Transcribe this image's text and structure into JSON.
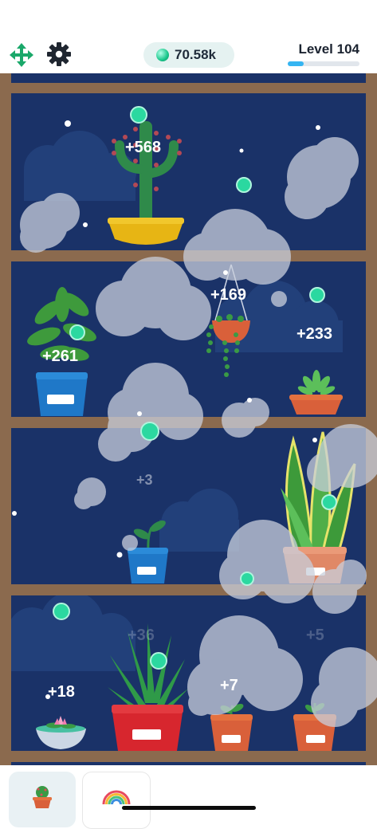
{
  "header": {
    "move_icon": "move-arrows-icon",
    "settings_icon": "gear-icon",
    "currency": {
      "icon": "green-gem-icon",
      "value": "70.58k"
    },
    "level": {
      "label": "Level 104",
      "progress": 0.22
    }
  },
  "shelves": [
    {
      "name": "top-shelf",
      "plants": [
        "cactus-in-yellow-bowl"
      ]
    },
    {
      "name": "second-shelf",
      "plants": [
        "fern-in-blue-pot",
        "hanging-pearl-plant",
        "succulent-in-terracotta-dish"
      ]
    },
    {
      "name": "third-shelf",
      "plants": [
        "seedling-in-blue-pot",
        "snake-plant-in-salmon-pot"
      ]
    },
    {
      "name": "bottom-shelf",
      "plants": [
        "water-lily-bowl",
        "aloe-in-red-pot",
        "sprout-in-terracotta-pot",
        "sprout-in-small-terracotta-pot"
      ]
    }
  ],
  "floating_rewards": {
    "cactus": "+568",
    "hanging": "+169",
    "fern": "+261",
    "succulent": "+233",
    "seedling": "+3",
    "waterlily": "+18",
    "sprout": "+7",
    "aloe_faded": "+36",
    "right_faded": "+5"
  },
  "colors": {
    "night_sky": "#1a3268",
    "shelf_wood": "#8b6a4e",
    "gem": "#19c68a",
    "level_bar": "#35b5f2"
  },
  "bottom_tabs": [
    {
      "name": "plants-tab",
      "icon": "potted-cactus-icon"
    },
    {
      "name": "rainbow-tab",
      "icon": "rainbow-icon"
    }
  ]
}
